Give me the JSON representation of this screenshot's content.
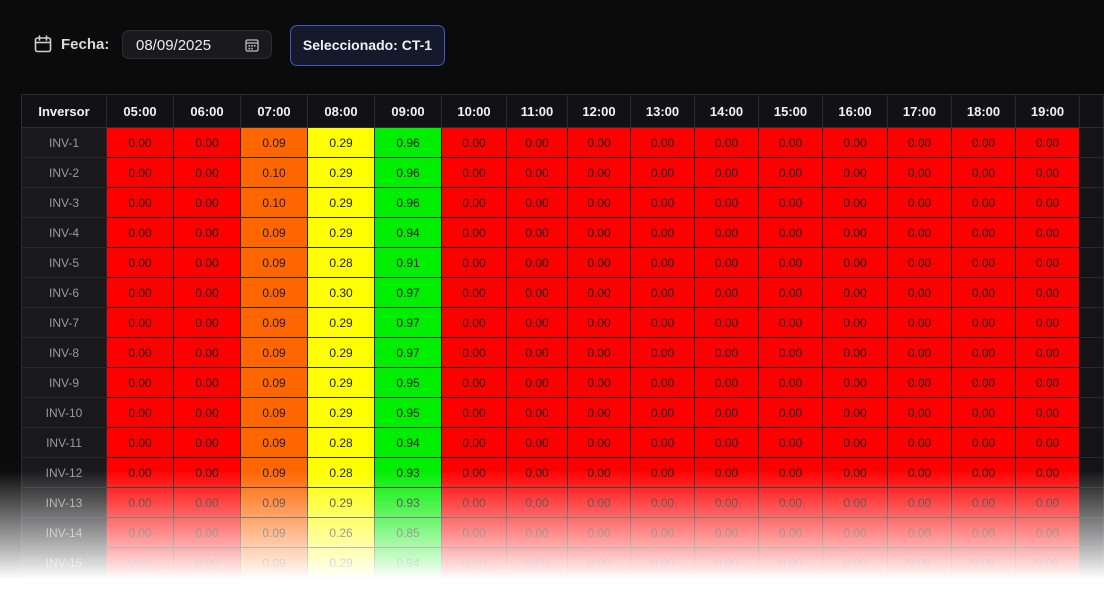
{
  "header": {
    "date_label": "Fecha:",
    "date_value": "08/09/2025",
    "selected_label": "Seleccionado: CT-1"
  },
  "colors": {
    "low": "#ff0000",
    "mid_low": "#ff6600",
    "mid": "#ffff00",
    "high": "#00ee00"
  },
  "table": {
    "row_header": "Inversor",
    "hours": [
      "05:00",
      "06:00",
      "07:00",
      "08:00",
      "09:00",
      "10:00",
      "11:00",
      "12:00",
      "13:00",
      "14:00",
      "15:00",
      "16:00",
      "17:00",
      "18:00",
      "19:00"
    ],
    "rows": [
      {
        "name": "INV-1",
        "values": [
          "0.00",
          "0.00",
          "0.09",
          "0.29",
          "0.96",
          "0.00",
          "0.00",
          "0.00",
          "0.00",
          "0.00",
          "0.00",
          "0.00",
          "0.00",
          "0.00",
          "0.00"
        ]
      },
      {
        "name": "INV-2",
        "values": [
          "0.00",
          "0.00",
          "0.10",
          "0.29",
          "0.96",
          "0.00",
          "0.00",
          "0.00",
          "0.00",
          "0.00",
          "0.00",
          "0.00",
          "0.00",
          "0.00",
          "0.00"
        ]
      },
      {
        "name": "INV-3",
        "values": [
          "0.00",
          "0.00",
          "0.10",
          "0.29",
          "0.96",
          "0.00",
          "0.00",
          "0.00",
          "0.00",
          "0.00",
          "0.00",
          "0.00",
          "0.00",
          "0.00",
          "0.00"
        ]
      },
      {
        "name": "INV-4",
        "values": [
          "0.00",
          "0.00",
          "0.09",
          "0.29",
          "0.94",
          "0.00",
          "0.00",
          "0.00",
          "0.00",
          "0.00",
          "0.00",
          "0.00",
          "0.00",
          "0.00",
          "0.00"
        ]
      },
      {
        "name": "INV-5",
        "values": [
          "0.00",
          "0.00",
          "0.09",
          "0.28",
          "0.91",
          "0.00",
          "0.00",
          "0.00",
          "0.00",
          "0.00",
          "0.00",
          "0.00",
          "0.00",
          "0.00",
          "0.00"
        ]
      },
      {
        "name": "INV-6",
        "values": [
          "0.00",
          "0.00",
          "0.09",
          "0.30",
          "0.97",
          "0.00",
          "0.00",
          "0.00",
          "0.00",
          "0.00",
          "0.00",
          "0.00",
          "0.00",
          "0.00",
          "0.00"
        ]
      },
      {
        "name": "INV-7",
        "values": [
          "0.00",
          "0.00",
          "0.09",
          "0.29",
          "0.97",
          "0.00",
          "0.00",
          "0.00",
          "0.00",
          "0.00",
          "0.00",
          "0.00",
          "0.00",
          "0.00",
          "0.00"
        ]
      },
      {
        "name": "INV-8",
        "values": [
          "0.00",
          "0.00",
          "0.09",
          "0.29",
          "0.97",
          "0.00",
          "0.00",
          "0.00",
          "0.00",
          "0.00",
          "0.00",
          "0.00",
          "0.00",
          "0.00",
          "0.00"
        ]
      },
      {
        "name": "INV-9",
        "values": [
          "0.00",
          "0.00",
          "0.09",
          "0.29",
          "0.95",
          "0.00",
          "0.00",
          "0.00",
          "0.00",
          "0.00",
          "0.00",
          "0.00",
          "0.00",
          "0.00",
          "0.00"
        ]
      },
      {
        "name": "INV-10",
        "values": [
          "0.00",
          "0.00",
          "0.09",
          "0.29",
          "0.95",
          "0.00",
          "0.00",
          "0.00",
          "0.00",
          "0.00",
          "0.00",
          "0.00",
          "0.00",
          "0.00",
          "0.00"
        ]
      },
      {
        "name": "INV-11",
        "values": [
          "0.00",
          "0.00",
          "0.09",
          "0.28",
          "0.94",
          "0.00",
          "0.00",
          "0.00",
          "0.00",
          "0.00",
          "0.00",
          "0.00",
          "0.00",
          "0.00",
          "0.00"
        ]
      },
      {
        "name": "INV-12",
        "values": [
          "0.00",
          "0.00",
          "0.09",
          "0.28",
          "0.93",
          "0.00",
          "0.00",
          "0.00",
          "0.00",
          "0.00",
          "0.00",
          "0.00",
          "0.00",
          "0.00",
          "0.00"
        ]
      },
      {
        "name": "INV-13",
        "values": [
          "0.00",
          "0.00",
          "0.09",
          "0.29",
          "0.93",
          "0.00",
          "0.00",
          "0.00",
          "0.00",
          "0.00",
          "0.00",
          "0.00",
          "0.00",
          "0.00",
          "0.00"
        ]
      },
      {
        "name": "INV-14",
        "values": [
          "0.00",
          "0.00",
          "0.09",
          "0.26",
          "0.85",
          "0.00",
          "0.00",
          "0.00",
          "0.00",
          "0.00",
          "0.00",
          "0.00",
          "0.00",
          "0.00",
          "0.00"
        ]
      },
      {
        "name": "INV-15",
        "values": [
          "0.00",
          "0.00",
          "0.09",
          "0.29",
          "0.94",
          "0.00",
          "0.00",
          "0.00",
          "0.00",
          "0.00",
          "0.00",
          "0.00",
          "0.00",
          "0.00",
          "0.00"
        ]
      }
    ]
  }
}
